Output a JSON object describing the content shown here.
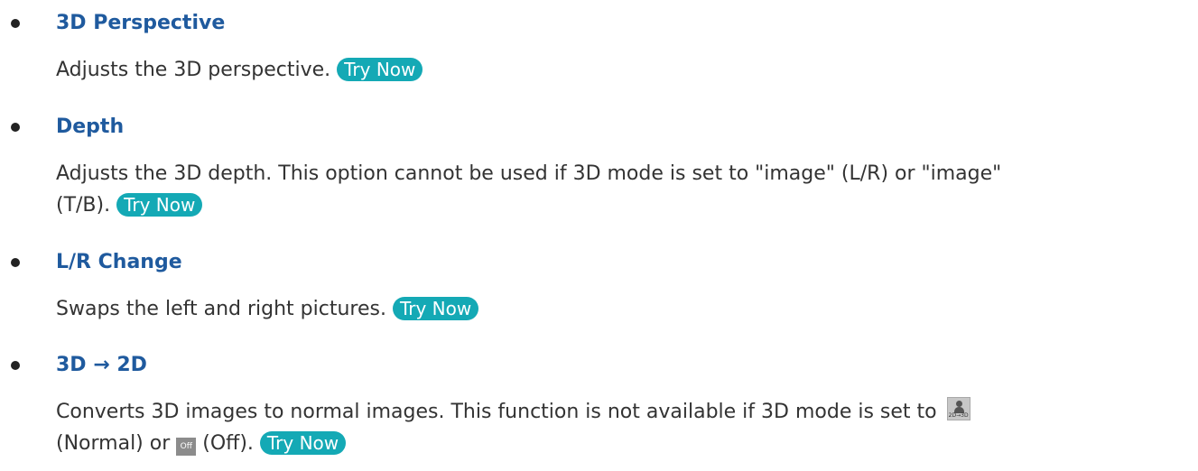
{
  "items": [
    {
      "title": "3D Perspective",
      "desc_line1": "Adjusts the 3D perspective.",
      "try_now": "Try Now"
    },
    {
      "title": "Depth",
      "desc_line1": "Adjusts the 3D depth. This option cannot be used if 3D mode is set to \"image\" (L/R) or \"image\"",
      "desc_line2": "(T/B).",
      "try_now": "Try Now"
    },
    {
      "title": "L/R Change",
      "desc_line1": "Swaps the left and right pictures.",
      "try_now": "Try Now"
    },
    {
      "title": "3D → 2D",
      "desc_line1": "Converts 3D images to normal images. This function is not available if 3D mode is set to",
      "icon_normal": "2D→3D",
      "desc_normal": "(Normal) or",
      "icon_off": "Off",
      "desc_off": "(Off).",
      "try_now": "Try Now"
    }
  ],
  "icons": {
    "bullet": "bullet-dot-icon",
    "mode_normal": "2d-to-3d-mode-icon",
    "mode_off": "off-mode-icon"
  },
  "colors": {
    "title": "#1f5a9e",
    "try_now_bg": "#14a9b5",
    "body_text": "#333333"
  }
}
